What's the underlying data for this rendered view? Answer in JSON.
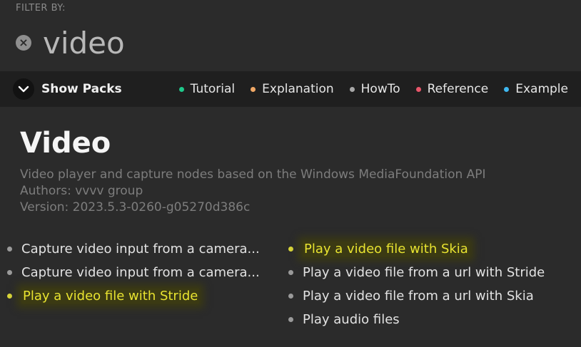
{
  "filter": {
    "label": "FILTER BY:",
    "value": "video",
    "clear_icon": "close-circle-icon"
  },
  "bar": {
    "toggle_icon": "chevron-down-icon",
    "show_packs_label": "Show Packs",
    "legend": [
      {
        "label": "Tutorial",
        "color": "#1fc98b"
      },
      {
        "label": "Explanation",
        "color": "#f0a866"
      },
      {
        "label": "HowTo",
        "color": "#a8a8a8"
      },
      {
        "label": "Reference",
        "color": "#e8566a"
      },
      {
        "label": "Example",
        "color": "#3fb8f0"
      }
    ]
  },
  "pack": {
    "title": "Video",
    "description": "Video player and capture nodes based on the Windows MediaFoundation API",
    "authors": "Authors: vvvv group",
    "version": "Version: 2023.5.3-0260-g05270d386c"
  },
  "items_col1": [
    {
      "label": "Capture video input from a camera...",
      "highlighted": false
    },
    {
      "label": "Capture video input from a camera...",
      "highlighted": false
    },
    {
      "label": "Play a video file with Stride",
      "highlighted": true
    }
  ],
  "items_col2": [
    {
      "label": "Play a video file with Skia",
      "highlighted": true
    },
    {
      "label": "Play a video file from a url with Stride",
      "highlighted": false
    },
    {
      "label": "Play a video file from a url with Skia",
      "highlighted": false
    },
    {
      "label": "Play audio files",
      "highlighted": false
    }
  ],
  "colors": {
    "background": "#2b2b2b",
    "bar": "#1f1f1f",
    "highlight_text": "#e8e330"
  }
}
